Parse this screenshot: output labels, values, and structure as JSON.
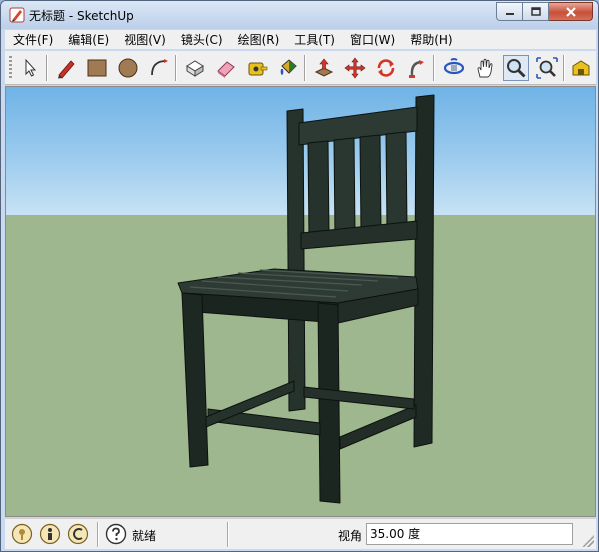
{
  "window": {
    "title": "无标题 - SketchUp",
    "app_icon": "sketchup-pencil-icon",
    "controls": [
      "minimize-icon",
      "maximize-icon",
      "close-icon"
    ]
  },
  "menubar": {
    "items": [
      {
        "label": "文件(F)"
      },
      {
        "label": "编辑(E)"
      },
      {
        "label": "视图(V)"
      },
      {
        "label": "镜头(C)"
      },
      {
        "label": "绘图(R)"
      },
      {
        "label": "工具(T)"
      },
      {
        "label": "窗口(W)"
      },
      {
        "label": "帮助(H)"
      }
    ]
  },
  "toolbar": {
    "tools": [
      {
        "name": "select-tool",
        "icon": "arrow-cursor-icon"
      },
      {
        "name": "line-tool",
        "icon": "pencil-icon"
      },
      {
        "name": "rectangle-tool",
        "icon": "rectangle-icon"
      },
      {
        "name": "circle-tool",
        "icon": "circle-icon"
      },
      {
        "name": "arc-tool",
        "icon": "arc-icon"
      },
      {
        "name": "make-component-tool",
        "icon": "component-icon"
      },
      {
        "name": "eraser-tool",
        "icon": "eraser-icon"
      },
      {
        "name": "tape-measure-tool",
        "icon": "tape-measure-icon"
      },
      {
        "name": "paint-bucket-tool",
        "icon": "paint-bucket-icon"
      },
      {
        "name": "push-pull-tool",
        "icon": "push-pull-icon"
      },
      {
        "name": "move-tool",
        "icon": "move-arrows-icon"
      },
      {
        "name": "rotate-tool",
        "icon": "rotate-icon"
      },
      {
        "name": "follow-me-tool",
        "icon": "follow-me-icon"
      },
      {
        "name": "orbit-tool",
        "icon": "orbit-icon"
      },
      {
        "name": "pan-tool",
        "icon": "hand-icon"
      },
      {
        "name": "zoom-tool",
        "icon": "zoom-magnifier-icon",
        "active": true
      },
      {
        "name": "zoom-extents-tool",
        "icon": "zoom-extents-icon"
      },
      {
        "name": "warehouse-tool",
        "icon": "warehouse-icon"
      }
    ]
  },
  "viewport": {
    "model": "chair",
    "colors": {
      "sky": "#8cc3ec",
      "ground": "#9fb78e",
      "chair": "#1f2a24"
    }
  },
  "statusbar": {
    "icons": [
      "geolocation-icon",
      "credits-icon",
      "instructor-icon",
      "help-icon"
    ],
    "status_text": "就绪",
    "measure_label": "视角",
    "measure_value": "35.00 度"
  }
}
